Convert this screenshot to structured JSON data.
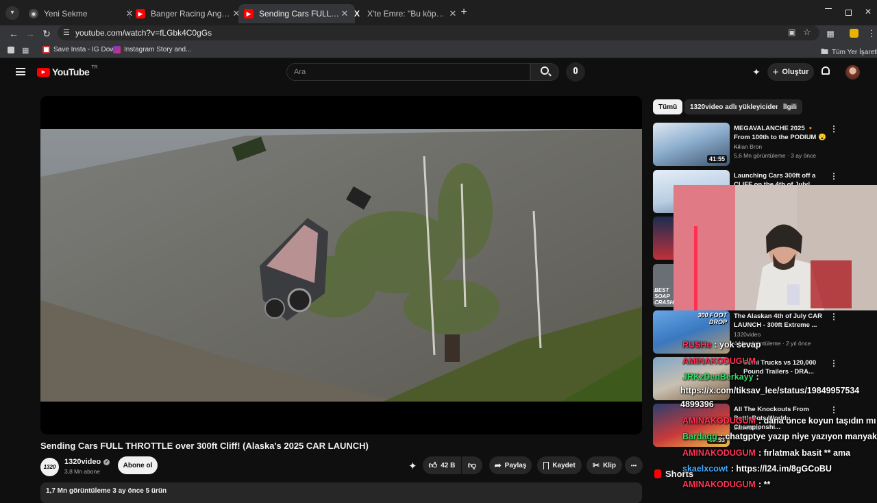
{
  "browser": {
    "tabs": [
      {
        "title": "Yeni Sekme"
      },
      {
        "title": "Banger Racing Angmering Raceway"
      },
      {
        "title": "Sending Cars FULL THROTTLE over 300ft Cliff!"
      },
      {
        "title": "X'te Emre: \"Bu köpek sizin olsaydı\""
      }
    ],
    "new_tab": "+",
    "url": "youtube.com/watch?v=fLGbk4C0gGs",
    "bookmarks": [
      "Save Insta - IG Dow...",
      "Instagram Story and..."
    ],
    "all_bookmarks": "Tüm Yer İşaretleri"
  },
  "youtube": {
    "logo": "YouTube",
    "region": "TR",
    "search_placeholder": "Ara",
    "create_label": "Oluştur"
  },
  "video": {
    "title": "Sending Cars FULL THROTTLE over 300ft Cliff! (Alaska's 2025 CAR LAUNCH)",
    "channel": "1320video",
    "channel_logo": "1320",
    "subscribers": "3,8 Mn abone",
    "subscribe_label": "Abone ol",
    "likes": "42 B",
    "share_label": "Paylaş",
    "save_label": "Kaydet",
    "clip_label": "Klip",
    "more": "•••",
    "description_meta": "1,7 Mn görüntüleme  3 ay önce  5 ürün"
  },
  "recommended": {
    "chips": [
      "Tümü",
      "1320video adlı yükleyiciden",
      "İlgili"
    ],
    "items": [
      {
        "title": "MEGAVALANCHE 2025 🔸 From 100th to the PODIUM 😮 ...",
        "channel": "Kilian Bron",
        "meta": "5,6 Mn görüntüleme · 3 ay önce",
        "duration": "41:55",
        "thumb_color": "#6a8fb8"
      },
      {
        "title": "Launching Cars 300ft off a CLIFF on the 4th of July!",
        "channel": "",
        "meta": "",
        "duration": "",
        "thumb_color": "#7a9cc0"
      },
      {
        "title": "The Alaskan 4th of July CAR LAUNCH - 300ft Extreme ...",
        "channel": "1320video",
        "meta": "4 Mn görüntüleme · 2 yıl önce",
        "duration": "",
        "thumb_color": "#4c7fb5"
      },
      {
        "title": "Semi Trucks vs 120,000 Pound Trailers - DRA...",
        "channel": "",
        "meta": "",
        "duration": "",
        "thumb_color": "#8a6a50"
      },
      {
        "title": "All The Knockouts From BattleBots World Championshi...",
        "channel": "BattleBots",
        "meta": "",
        "duration": "39:53",
        "thumb_color": "#3a5c88"
      }
    ],
    "shorts_label": "Shorts",
    "thumb_texts": {
      "drop": "300 FOOT DROP",
      "soap": "BEST SOAP CRASH"
    }
  },
  "chat": [
    {
      "user": "RUSHe",
      "text": ": yok sevap",
      "color": "#ff3355"
    },
    {
      "user": "AMINAKODUGUM",
      "text": ": ",
      "color": "#ff3355"
    },
    {
      "user": "JRKzDenBerkayy",
      "text": ": ",
      "color": "#33dd66"
    },
    {
      "user": "",
      "text": "https://x.com/tiksav_lee/status/19849957534",
      "color": "#ffffff"
    },
    {
      "user": "",
      "text": "4899396",
      "color": "#ffffff"
    },
    {
      "user": "AMINAKODUGUM",
      "text": ": dana önce koyun taşıdın mı",
      "color": "#ff3355"
    },
    {
      "user": "Bardagg",
      "text": ": chatgptye yazıp niye yazıyon manyak",
      "color": "#33dd66"
    },
    {
      "user": "AMINAKODUGUM",
      "text": ": fırlatmak basit ** ama",
      "color": "#ff3355"
    },
    {
      "user": "skaelxcowt",
      "text": ": https://l24.im/8gGCoBU",
      "color": "#44aaff"
    },
    {
      "user": "AMINAKODUGUM",
      "text": ": **",
      "color": "#ff3355"
    }
  ]
}
